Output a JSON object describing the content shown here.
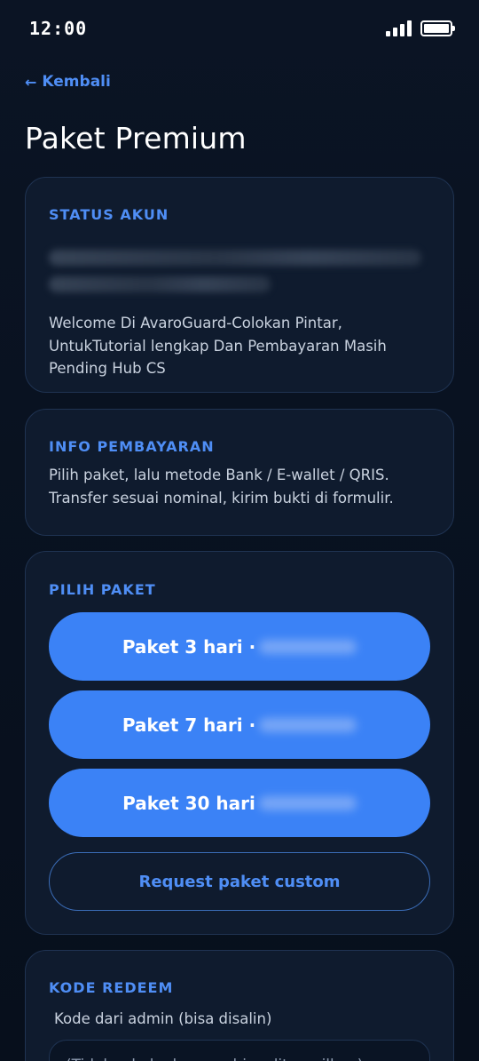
{
  "status_bar": {
    "time": "12:00"
  },
  "header": {
    "back_label": "Kembali",
    "title": "Paket Premium"
  },
  "status_card": {
    "label": "STATUS AKUN",
    "message": "Welcome Di AvaroGuard-Colokan Pintar, UntukTutorial lengkap Dan Pembayaran Masih Pending Hub CS"
  },
  "info_card": {
    "label": "INFO PEMBAYARAN",
    "text": "Pilih paket, lalu metode Bank / E-wallet / QRIS. Transfer sesuai nominal, kirim bukti di formulir."
  },
  "paket_card": {
    "label": "PILIH PAKET",
    "options": [
      {
        "label": "Paket 3 hari ·"
      },
      {
        "label": "Paket 7 hari ·"
      },
      {
        "label": "Paket 30 hari"
      }
    ],
    "custom_label": "Request paket custom"
  },
  "redeem_card": {
    "label": "KODE REDEEM",
    "hint": "Kode dari admin (bisa disalin)",
    "placeholder": "(Tidak ada kode yang bisa ditampilkan)"
  },
  "colors": {
    "accent": "#4f8ef5",
    "button": "#3b82f6",
    "background": "#0a1322",
    "card": "#0f1b2e"
  },
  "icons": {
    "back": "arrow-left-icon",
    "signal": "signal-icon",
    "battery": "battery-icon"
  }
}
